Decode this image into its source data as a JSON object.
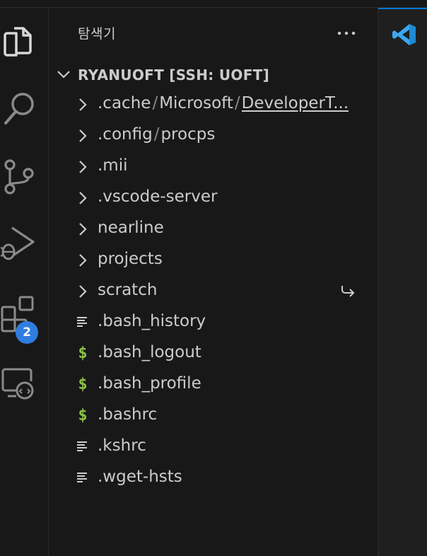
{
  "sidebar": {
    "title": "탐색기",
    "more_actions_label": "···"
  },
  "workspace": {
    "name": "RYANUOFT [SSH: UOFT]",
    "expanded": true
  },
  "tree": [
    {
      "type": "folder",
      "parts": [
        ".cache",
        "Microsoft",
        "DeveloperT..."
      ]
    },
    {
      "type": "folder",
      "parts": [
        ".config",
        "procps"
      ]
    },
    {
      "type": "folder",
      "label": ".mii"
    },
    {
      "type": "folder",
      "label": ".vscode-server"
    },
    {
      "type": "folder",
      "label": "nearline"
    },
    {
      "type": "folder",
      "label": "projects"
    },
    {
      "type": "folder",
      "label": "scratch",
      "symlink": true
    },
    {
      "type": "file",
      "icon": "lines-file-icon",
      "label": ".bash_history"
    },
    {
      "type": "file",
      "icon": "shell-dollar-icon",
      "label": ".bash_logout"
    },
    {
      "type": "file",
      "icon": "shell-dollar-icon",
      "label": ".bash_profile"
    },
    {
      "type": "file",
      "icon": "shell-dollar-icon",
      "label": ".bashrc"
    },
    {
      "type": "file",
      "icon": "lines-file-icon",
      "label": ".kshrc"
    },
    {
      "type": "file",
      "icon": "lines-file-icon",
      "label": ".wget-hsts"
    }
  ],
  "activity_bar": {
    "items": [
      "explorer",
      "search",
      "source-control",
      "run-and-debug",
      "extensions",
      "remote-explorer"
    ],
    "extensions_badge": "2"
  },
  "colors": {
    "background": "#181818",
    "text": "#cccccc",
    "shell_icon": "#8dc149",
    "badge": "#2f7de1",
    "accent": "#0078d4"
  }
}
